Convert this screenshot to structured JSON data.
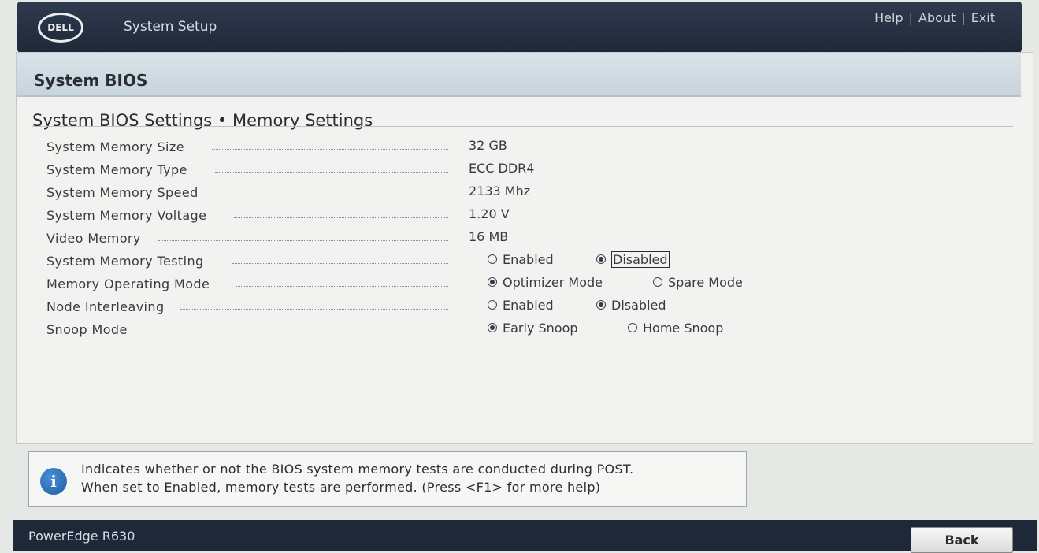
{
  "header": {
    "logo_text": "DELL",
    "app_title": "System Setup",
    "links": [
      "Help",
      "About",
      "Exit"
    ]
  },
  "panel": {
    "title": "System BIOS",
    "breadcrumb": "System BIOS Settings • Memory Settings"
  },
  "settings": [
    {
      "label": "System Memory Size",
      "value": "32 GB"
    },
    {
      "label": "System Memory Type",
      "value": "ECC DDR4"
    },
    {
      "label": "System Memory Speed",
      "value": "2133 Mhz"
    },
    {
      "label": "System Memory Voltage",
      "value": "1.20 V"
    },
    {
      "label": "Video Memory",
      "value": "16 MB"
    },
    {
      "label": "System Memory Testing",
      "options": [
        "Enabled",
        "Disabled"
      ],
      "selected": "Disabled"
    },
    {
      "label": "Memory Operating Mode",
      "options": [
        "Optimizer Mode",
        "Spare Mode"
      ],
      "selected": "Optimizer Mode"
    },
    {
      "label": "Node Interleaving",
      "options": [
        "Enabled",
        "Disabled"
      ],
      "selected": "Disabled"
    },
    {
      "label": "Snoop Mode",
      "options": [
        "Early Snoop",
        "Home Snoop"
      ],
      "selected": "Early Snoop"
    }
  ],
  "help": {
    "line1": "Indicates whether or not the BIOS system memory tests are conducted during POST.",
    "line2": "When set to Enabled, memory tests are performed. (Press <F1> for more help)"
  },
  "footer": {
    "model": "PowerEdge R630",
    "back_label": "Back"
  },
  "colors": {
    "header_bg": "#1f2838",
    "panel_head_bg": "#c8d3db",
    "info_icon": "#1b5ba6"
  }
}
